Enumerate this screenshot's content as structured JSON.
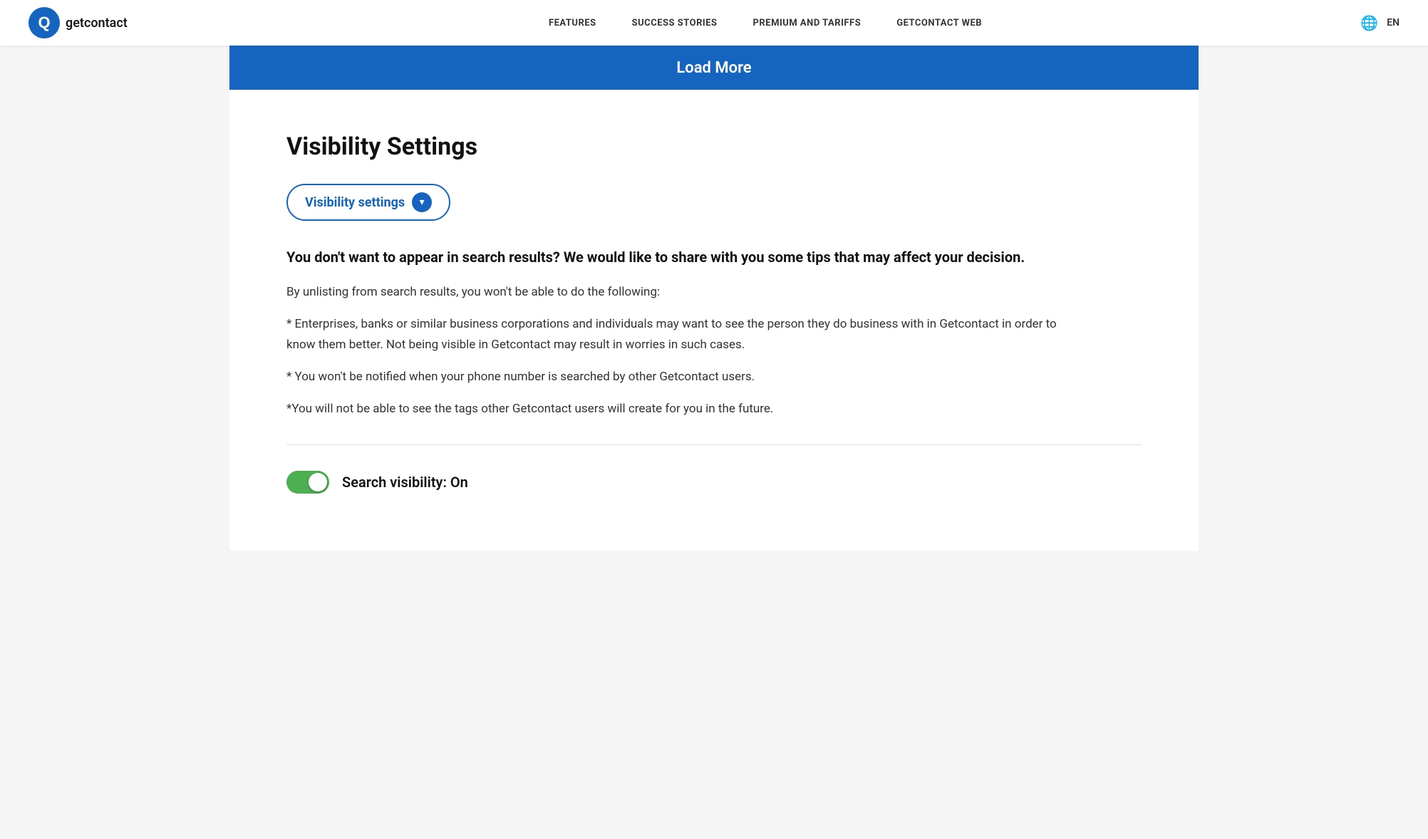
{
  "navbar": {
    "logo_text": "getcontact",
    "links": [
      {
        "label": "FEATURES",
        "id": "features"
      },
      {
        "label": "SUCCESS STORIES",
        "id": "success-stories"
      },
      {
        "label": "PREMIUM AND TARIFFS",
        "id": "premium-tariffs"
      },
      {
        "label": "GETCONTACT WEB",
        "id": "getcontact-web"
      }
    ],
    "lang": "EN"
  },
  "load_more": {
    "label": "Load More"
  },
  "visibility_settings": {
    "section_title": "Visibility Settings",
    "dropdown_button_label": "Visibility settings",
    "chevron": "▾",
    "desc_heading": "You don't want to appear in search results? We would like to share with you some tips that may affect your decision.",
    "desc_intro": "By unlisting from search results, you won't be able to do the following:",
    "bullet_1": "* Enterprises, banks or similar business corporations and individuals may want to see the person they do business with in Getcontact in order to know them better. Not being visible in Getcontact may result in worries in such cases.",
    "bullet_2": "* You won't be notified when your phone number is searched by other Getcontact users.",
    "bullet_3": "*You will not be able to see the tags other Getcontact users will create for you in the future.",
    "toggle_label": "Search visibility: On",
    "toggle_state": true
  },
  "colors": {
    "brand_blue": "#1565C0",
    "toggle_green": "#4CAF50",
    "banner_blue": "#1565C0"
  }
}
